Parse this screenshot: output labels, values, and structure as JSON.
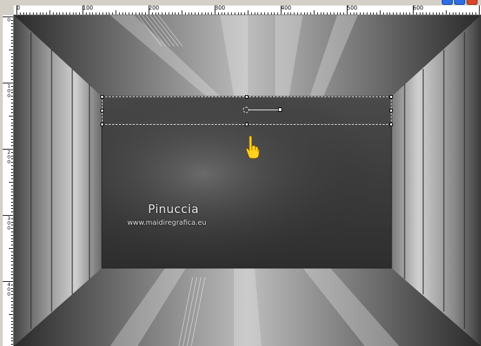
{
  "window": {
    "buttons": [
      "minimize",
      "maximize",
      "close"
    ]
  },
  "rulers": {
    "horizontal_labels": [
      "0",
      "100",
      "200",
      "300",
      "400",
      "500",
      "600"
    ],
    "vertical_labels": [
      "0",
      "100",
      "200",
      "300",
      "400"
    ]
  },
  "canvas": {
    "background_color": "#5a5a5a",
    "panel_color": "#3a3a3a"
  },
  "watermark": {
    "name": "Pinuccia",
    "url": "www.maidiregrafica.eu"
  },
  "tools": {
    "cursor_icon": "pointing-hand-cursor",
    "selection": "pick-tool-selection"
  }
}
